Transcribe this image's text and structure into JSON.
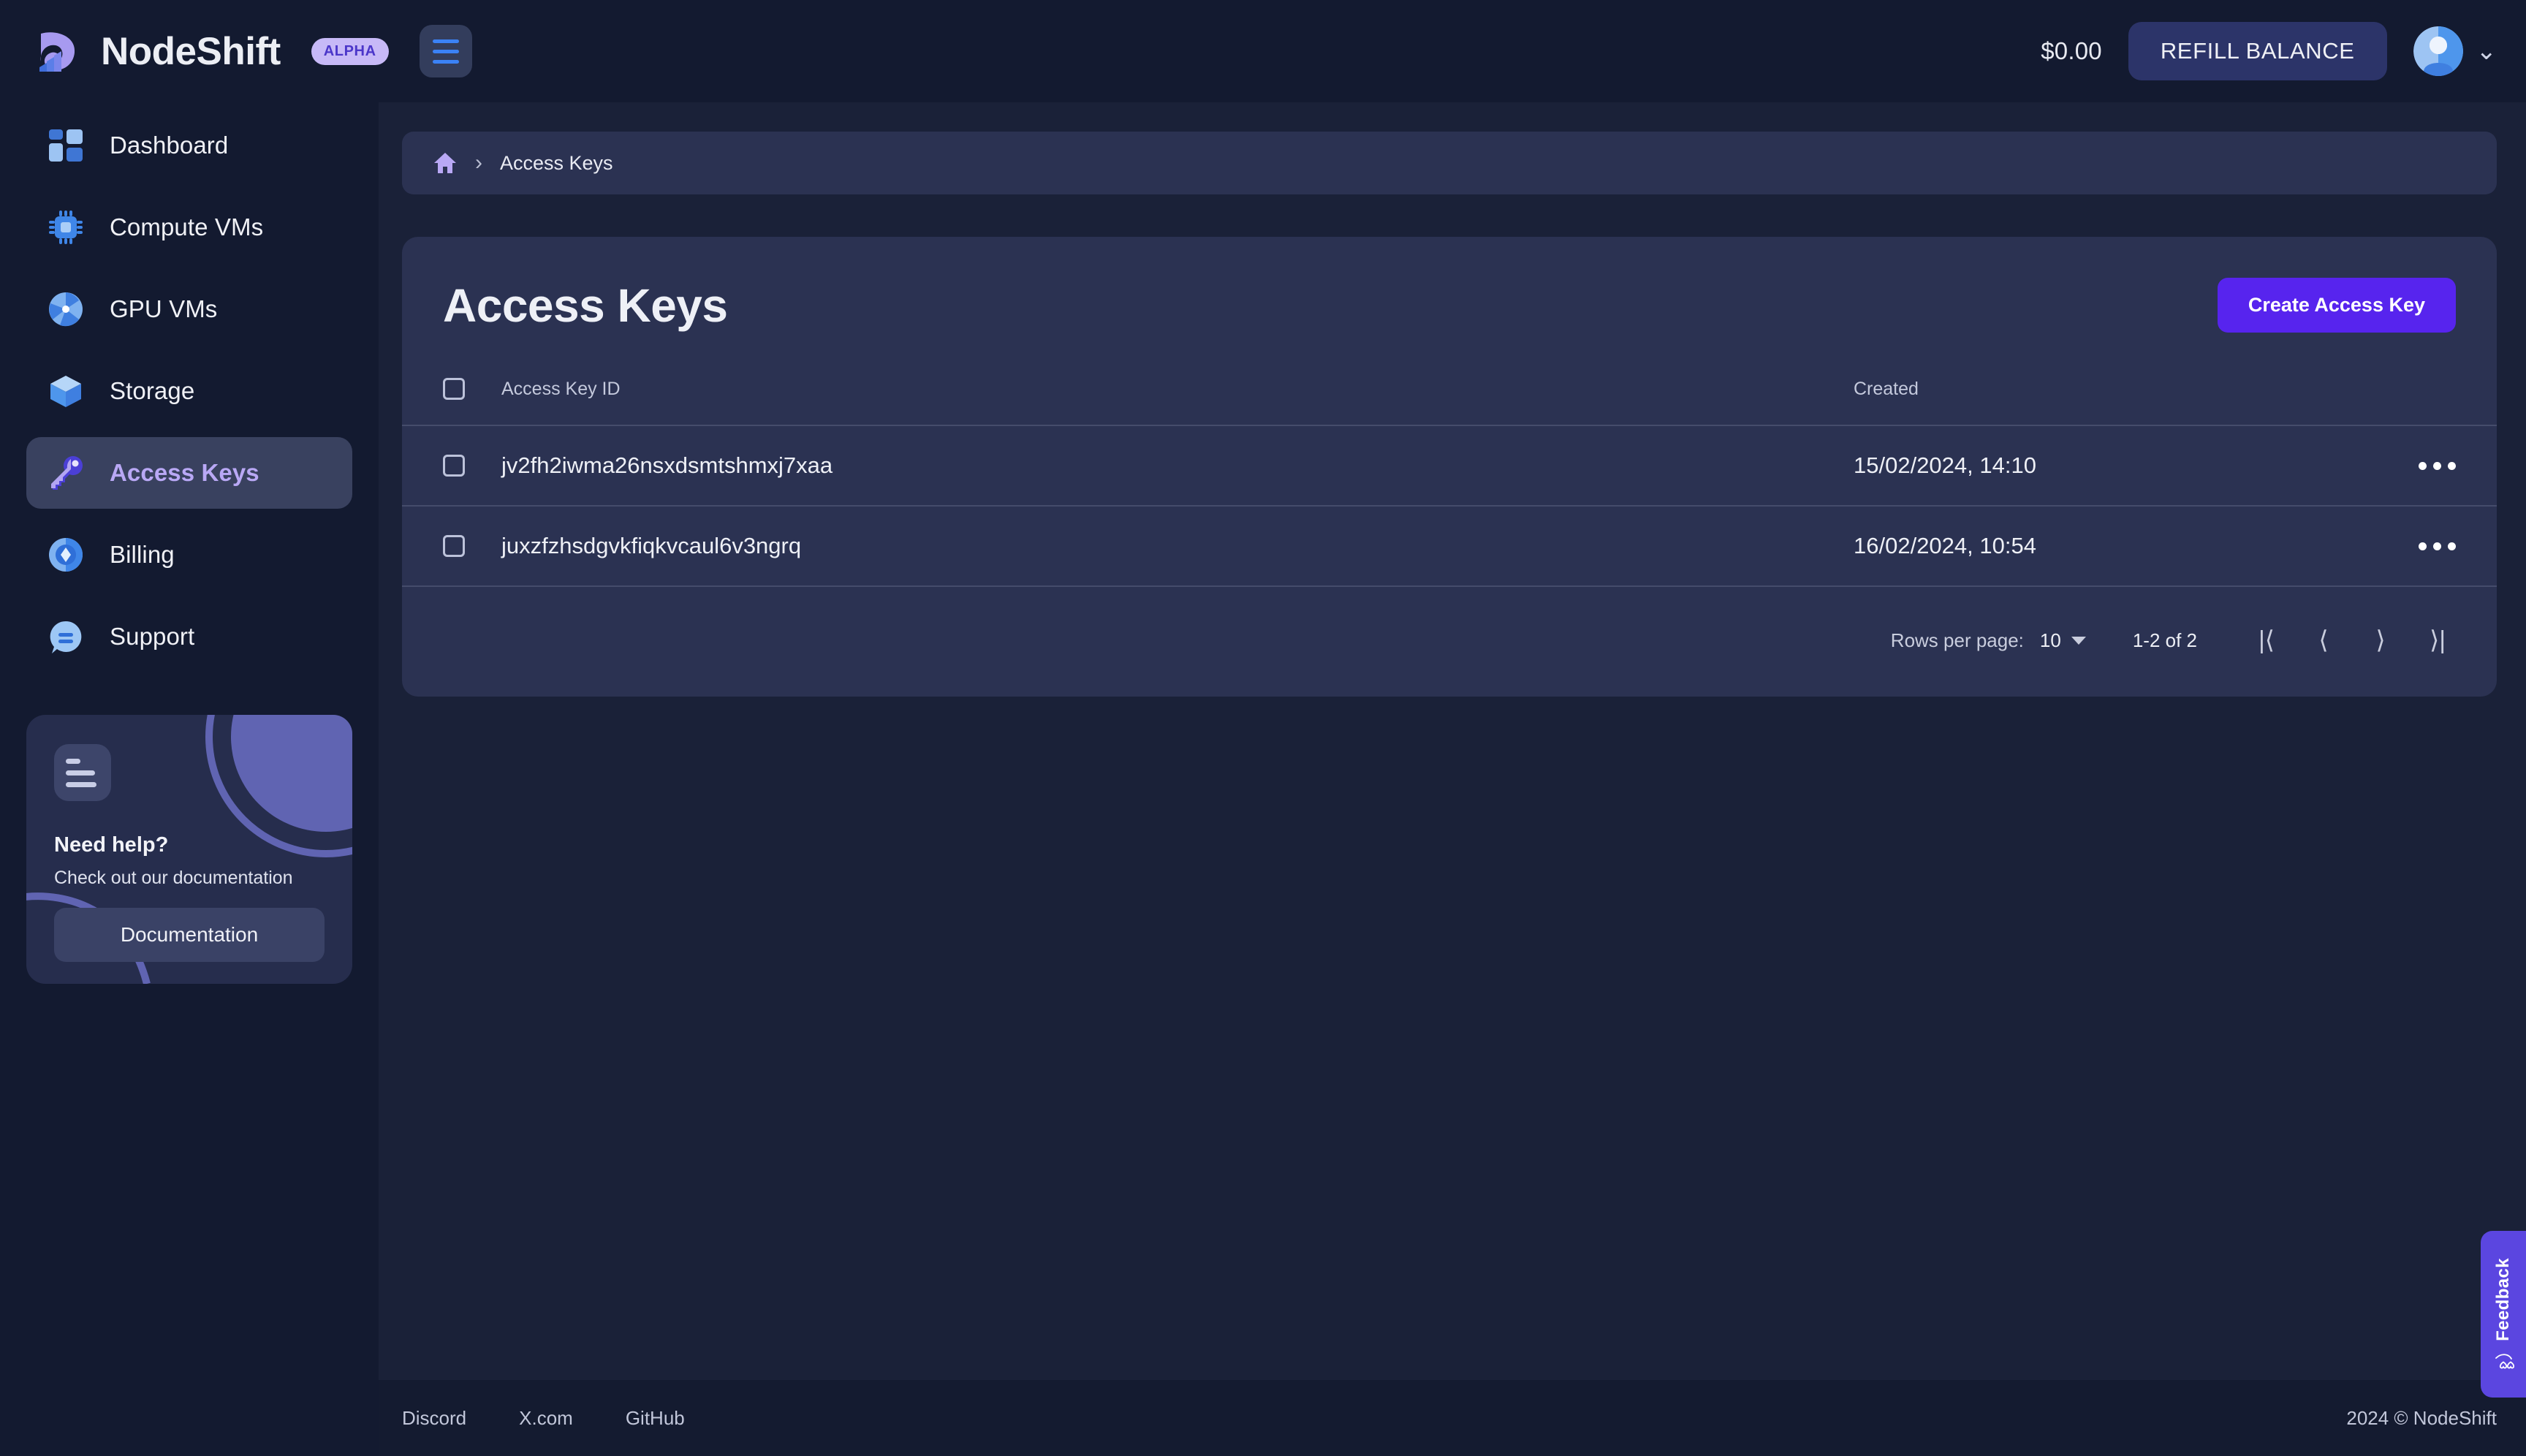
{
  "brand": {
    "name": "NodeShift",
    "badge": "ALPHA",
    "logo_icon": "nodeshift-wave-logo",
    "menu_icon": "hamburger-menu-icon"
  },
  "topbar": {
    "balance": "$0.00",
    "refill_label": "REFILL BALANCE",
    "avatar_icon": "user-avatar-icon",
    "chevron_icon": "chevron-down-icon"
  },
  "sidebar": {
    "items": [
      {
        "label": "Dashboard",
        "icon": "dashboard-grid-icon",
        "active": false
      },
      {
        "label": "Compute VMs",
        "icon": "cpu-chip-icon",
        "active": false
      },
      {
        "label": "GPU VMs",
        "icon": "gpu-fan-icon",
        "active": false
      },
      {
        "label": "Storage",
        "icon": "storage-cube-icon",
        "active": false
      },
      {
        "label": "Access Keys",
        "icon": "key-icon",
        "active": true
      },
      {
        "label": "Billing",
        "icon": "billing-diamond-icon",
        "active": false
      },
      {
        "label": "Support",
        "icon": "support-chat-icon",
        "active": false
      }
    ],
    "help_card": {
      "icon": "document-lines-icon",
      "title": "Need help?",
      "subtitle": "Check out our documentation",
      "button_label": "Documentation"
    }
  },
  "breadcrumb": {
    "home_icon": "home-icon",
    "separator": "›",
    "current": "Access Keys"
  },
  "page": {
    "title": "Access Keys",
    "create_button": "Create Access Key"
  },
  "table": {
    "select_all_checkbox": "unchecked",
    "columns": [
      "Access Key ID",
      "Created"
    ],
    "rows": [
      {
        "checked": false,
        "access_key_id": "jv2fh2iwma26nsxdsmtshmxj7xaa",
        "created": "15/02/2024, 14:10",
        "menu_icon": "more-options-icon"
      },
      {
        "checked": false,
        "access_key_id": "juxzfzhsdgvkfiqkvcaul6v3ngrq",
        "created": "16/02/2024, 10:54",
        "menu_icon": "more-options-icon"
      }
    ]
  },
  "pagination": {
    "rows_per_page_label": "Rows per page:",
    "rows_per_page_value": "10",
    "range": "1-2 of 2",
    "first_icon": "first-page-icon",
    "prev_icon": "previous-page-icon",
    "next_icon": "next-page-icon",
    "last_icon": "last-page-icon"
  },
  "footer": {
    "links": [
      "Discord",
      "X.com",
      "GitHub"
    ],
    "copyright": "2024 © NodeShift"
  },
  "feedback": {
    "label": "Feedback",
    "icon": "smiley-hearts-icon"
  },
  "colors": {
    "page_bg": "#131a30",
    "content_bg": "#1a2138",
    "panel_bg": "#2b3252",
    "accent_purple": "#5724ee",
    "active_nav": "#39415f",
    "active_nav_text": "#b9a8f5",
    "refill_bg": "#2c3469",
    "feedback_bg": "#5b46e0",
    "badge_bg": "#c7b9f7"
  }
}
